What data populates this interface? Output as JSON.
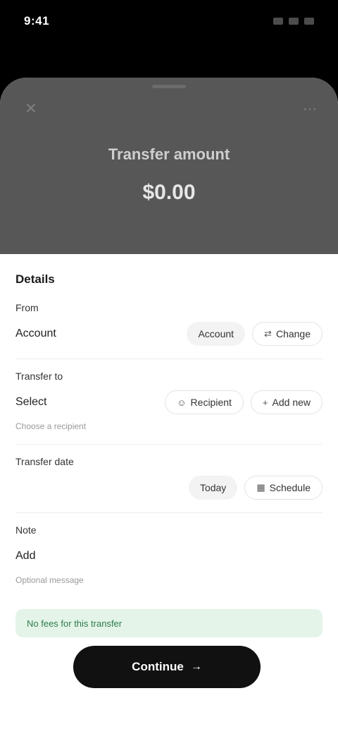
{
  "status_bar": {
    "time": "9:41",
    "icons": [
      "signal-icon",
      "wifi-icon",
      "battery-icon"
    ]
  },
  "header": {
    "close_icon": "close-icon",
    "more_icon": "more-icon",
    "title": "Transfer amount",
    "amount": "$0.00"
  },
  "form": {
    "heading": "Details",
    "rows": [
      {
        "label": "From",
        "value": "Account",
        "hint": "",
        "chips": [
          "Account",
          "Change"
        ],
        "sub": ""
      },
      {
        "label": "Transfer to",
        "value": "Select",
        "hint": "",
        "chips": [
          "Recipient",
          "Add new"
        ],
        "sub": "Choose a recipient"
      },
      {
        "label": "Transfer date",
        "value": "",
        "hint": "",
        "chips": [
          "Today",
          "Schedule"
        ],
        "sub": ""
      },
      {
        "label": "Note",
        "value": "Add",
        "hint": "",
        "chips": [],
        "sub": "Optional message"
      }
    ]
  },
  "banner": {
    "text": "No fees for this transfer"
  },
  "primary_button": {
    "label": "Continue",
    "icon": "arrow-right-icon"
  },
  "colors": {
    "hero": "#575757",
    "button": "#111111",
    "banner": "#e4f4e9",
    "banner_text": "#2d7d4b"
  }
}
